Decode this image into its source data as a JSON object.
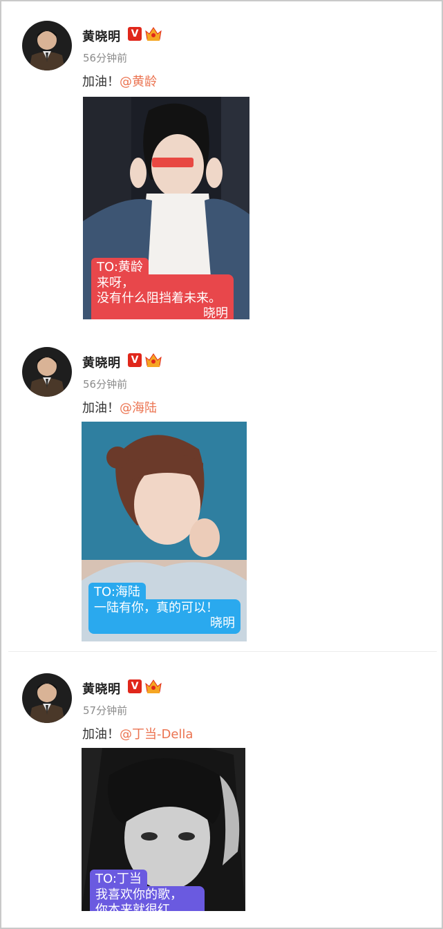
{
  "posts": [
    {
      "author": "黄晓明",
      "verified_badge": "V",
      "time": "56分钟前",
      "text_prefix": "加油！",
      "mention": "@黄龄",
      "caption": {
        "to": "TO:黄龄",
        "lines": [
          "来呀，",
          "没有什么阻挡着未来。"
        ],
        "signature": "晓明",
        "color": "#e8474b"
      }
    },
    {
      "author": "黄晓明",
      "verified_badge": "V",
      "time": "56分钟前",
      "text_prefix": "加油！",
      "mention": "@海陆",
      "caption": {
        "to": "TO:海陆",
        "lines": [
          "一陆有你，真的可以！"
        ],
        "signature": "晓明",
        "color": "#2aa9ee"
      }
    },
    {
      "author": "黄晓明",
      "verified_badge": "V",
      "time": "57分钟前",
      "text_prefix": "加油！",
      "mention": "@丁当-Della",
      "caption": {
        "to": "TO:丁当",
        "lines": [
          "我喜欢你的歌，",
          "你本来就很红"
        ],
        "signature": "",
        "color": "#6a5ae0"
      }
    }
  ],
  "icons": {
    "verified": "verified-v-icon",
    "crown": "crown-badge-icon"
  },
  "colors": {
    "mention": "#eb7350",
    "verified_red": "#e0271b",
    "time_gray": "#8b8b8b"
  }
}
